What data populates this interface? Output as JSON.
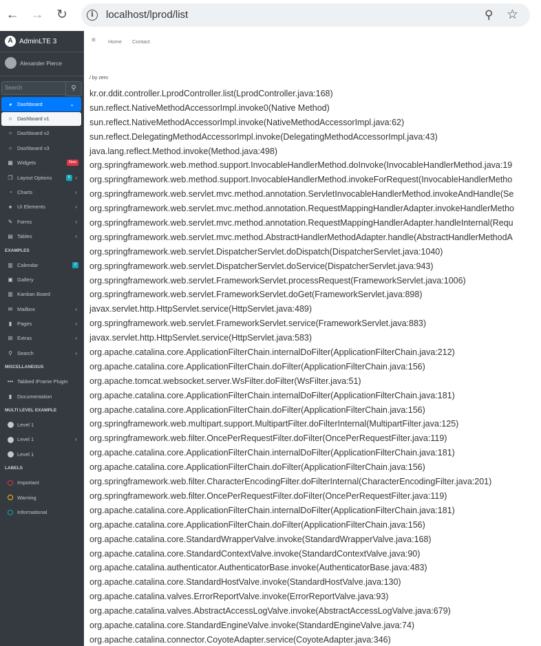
{
  "browser": {
    "url": "localhost/lprod/list",
    "back_icon": "←",
    "forward_icon": "→",
    "reload_icon": "↻",
    "info_icon": "i",
    "zoom_icon": "⚲",
    "star_icon": "☆"
  },
  "brand": {
    "logo": "A",
    "name": "AdminLTE 3"
  },
  "user": {
    "name": "Alexander Pierce"
  },
  "search": {
    "placeholder": "Search",
    "icon": "⚲"
  },
  "sidebar": {
    "dashboard": "Dashboard",
    "dashboard_v1": "Dashboard v1",
    "dashboard_v2": "Dashboard v2",
    "dashboard_v3": "Dashboard v3",
    "widgets": "Widgets",
    "widgets_badge": "New",
    "layout_options": "Layout Options",
    "layout_badge": "6",
    "charts": "Charts",
    "ui_elements": "UI Elements",
    "forms": "Forms",
    "tables": "Tables",
    "examples_header": "EXAMPLES",
    "calendar": "Calendar",
    "calendar_badge": "2",
    "gallery": "Gallery",
    "kanban": "Kanban Board",
    "mailbox": "Mailbox",
    "pages": "Pages",
    "extras": "Extras",
    "search": "Search",
    "misc_header": "MISCELLANEOUS",
    "tabbed_iframe": "Tabbed IFrame Plugin",
    "documentation": "Documentation",
    "multi_header": "MULTI LEVEL EXAMPLE",
    "level1_a": "Level 1",
    "level1_b": "Level 1",
    "level1_c": "Level 1",
    "labels_header": "LABELS",
    "important": "Important",
    "warning": "Warning",
    "informational": "Informational"
  },
  "topnav": {
    "menu_icon": "≡",
    "home": "Home",
    "contact": "Contact"
  },
  "breadcrumb": "/ by zero",
  "stack_trace": [
    "kr.or.ddit.controller.LprodController.list(LprodController.java:168)",
    "sun.reflect.NativeMethodAccessorImpl.invoke0(Native Method)",
    "sun.reflect.NativeMethodAccessorImpl.invoke(NativeMethodAccessorImpl.java:62)",
    "sun.reflect.DelegatingMethodAccessorImpl.invoke(DelegatingMethodAccessorImpl.java:43)",
    "java.lang.reflect.Method.invoke(Method.java:498)",
    "org.springframework.web.method.support.InvocableHandlerMethod.doInvoke(InvocableHandlerMethod.java:19",
    "org.springframework.web.method.support.InvocableHandlerMethod.invokeForRequest(InvocableHandlerMetho",
    "org.springframework.web.servlet.mvc.method.annotation.ServletInvocableHandlerMethod.invokeAndHandle(Se",
    "org.springframework.web.servlet.mvc.method.annotation.RequestMappingHandlerAdapter.invokeHandlerMetho",
    "org.springframework.web.servlet.mvc.method.annotation.RequestMappingHandlerAdapter.handleInternal(Requ",
    "org.springframework.web.servlet.mvc.method.AbstractHandlerMethodAdapter.handle(AbstractHandlerMethodA",
    "org.springframework.web.servlet.DispatcherServlet.doDispatch(DispatcherServlet.java:1040)",
    "org.springframework.web.servlet.DispatcherServlet.doService(DispatcherServlet.java:943)",
    "org.springframework.web.servlet.FrameworkServlet.processRequest(FrameworkServlet.java:1006)",
    "org.springframework.web.servlet.FrameworkServlet.doGet(FrameworkServlet.java:898)",
    "javax.servlet.http.HttpServlet.service(HttpServlet.java:489)",
    "org.springframework.web.servlet.FrameworkServlet.service(FrameworkServlet.java:883)",
    "javax.servlet.http.HttpServlet.service(HttpServlet.java:583)",
    "org.apache.catalina.core.ApplicationFilterChain.internalDoFilter(ApplicationFilterChain.java:212)",
    "org.apache.catalina.core.ApplicationFilterChain.doFilter(ApplicationFilterChain.java:156)",
    "org.apache.tomcat.websocket.server.WsFilter.doFilter(WsFilter.java:51)",
    "org.apache.catalina.core.ApplicationFilterChain.internalDoFilter(ApplicationFilterChain.java:181)",
    "org.apache.catalina.core.ApplicationFilterChain.doFilter(ApplicationFilterChain.java:156)",
    "org.springframework.web.multipart.support.MultipartFilter.doFilterInternal(MultipartFilter.java:125)",
    "org.springframework.web.filter.OncePerRequestFilter.doFilter(OncePerRequestFilter.java:119)",
    "org.apache.catalina.core.ApplicationFilterChain.internalDoFilter(ApplicationFilterChain.java:181)",
    "org.apache.catalina.core.ApplicationFilterChain.doFilter(ApplicationFilterChain.java:156)",
    "org.springframework.web.filter.CharacterEncodingFilter.doFilterInternal(CharacterEncodingFilter.java:201)",
    "org.springframework.web.filter.OncePerRequestFilter.doFilter(OncePerRequestFilter.java:119)",
    "org.apache.catalina.core.ApplicationFilterChain.internalDoFilter(ApplicationFilterChain.java:181)",
    "org.apache.catalina.core.ApplicationFilterChain.doFilter(ApplicationFilterChain.java:156)",
    "org.apache.catalina.core.StandardWrapperValve.invoke(StandardWrapperValve.java:168)",
    "org.apache.catalina.core.StandardContextValve.invoke(StandardContextValve.java:90)",
    "org.apache.catalina.authenticator.AuthenticatorBase.invoke(AuthenticatorBase.java:483)",
    "org.apache.catalina.core.StandardHostValve.invoke(StandardHostValve.java:130)",
    "org.apache.catalina.valves.ErrorReportValve.invoke(ErrorReportValve.java:93)",
    "org.apache.catalina.valves.AbstractAccessLogValve.invoke(AbstractAccessLogValve.java:679)",
    "org.apache.catalina.core.StandardEngineValve.invoke(StandardEngineValve.java:74)",
    "org.apache.catalina.connector.CoyoteAdapter.service(CoyoteAdapter.java:346)"
  ],
  "colors": {
    "sidebar_bg": "#343a40",
    "active": "#007bff",
    "badge_new": "#dc3545",
    "badge_info": "#17a2b8",
    "important": "#dc3545",
    "warning": "#ffc107",
    "informational": "#17a2b8"
  }
}
